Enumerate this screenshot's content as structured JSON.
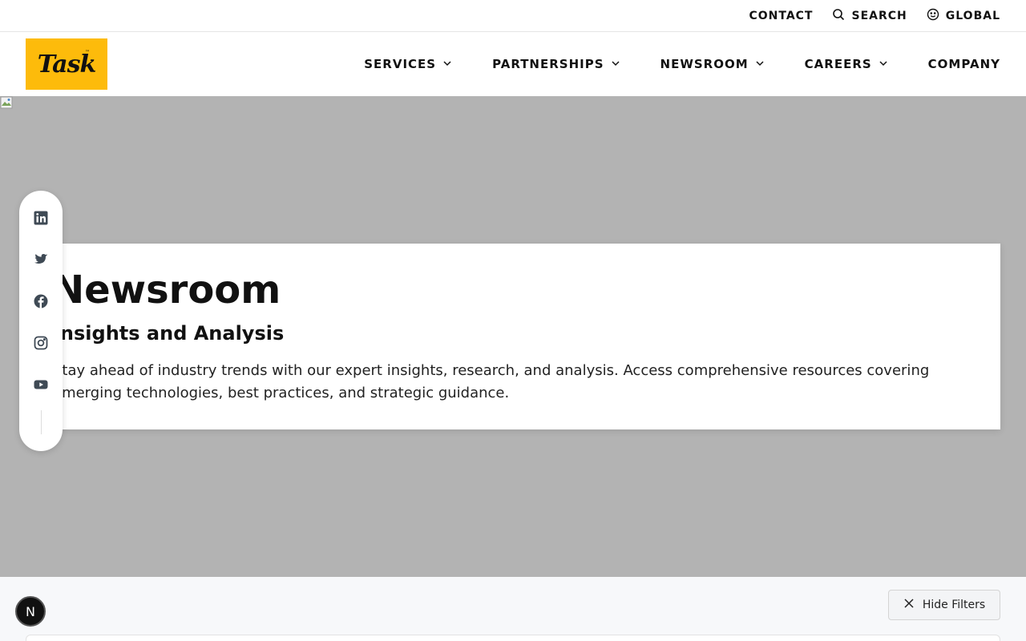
{
  "utility": {
    "contact": "CONTACT",
    "search": "SEARCH",
    "global": "GLOBAL"
  },
  "logo": {
    "text": "Task",
    "tm": "™",
    "bg_color": "#fdbb0b"
  },
  "nav": {
    "services": "SERVICES",
    "partnerships": "PARTNERSHIPS",
    "newsroom": "NEWSROOM",
    "careers": "CAREERS",
    "company": "COMPANY"
  },
  "hero": {
    "title": "Newsroom",
    "subtitle": "Insights and Analysis",
    "description": "Stay ahead of industry trends with our expert insights, research, and analysis. Access comprehensive resources covering emerging technologies, best practices, and strategic guidance.",
    "bg_color": "#b3b3b3"
  },
  "social": {
    "icons": [
      "linkedin-icon",
      "twitter-icon",
      "facebook-icon",
      "instagram-icon",
      "youtube-icon"
    ]
  },
  "filters": {
    "hide_label": "Hide Filters"
  },
  "badge": {
    "letter": "N"
  }
}
